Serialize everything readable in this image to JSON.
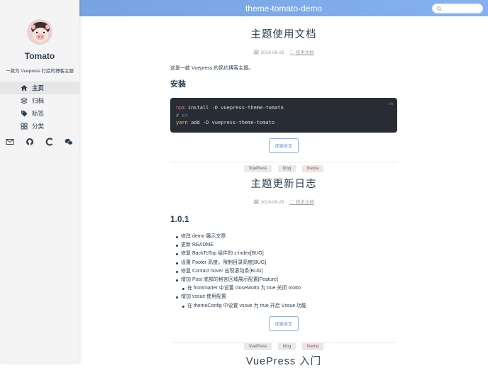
{
  "site": {
    "name": "Tomato",
    "description": "一款为 Vuepress 打造的博客主题",
    "header_title": "theme-tomato-demo"
  },
  "nav": [
    {
      "label": "主页",
      "icon": "home-icon",
      "active": true
    },
    {
      "label": "归档",
      "icon": "archive-icon",
      "active": false
    },
    {
      "label": "标签",
      "icon": "tag-icon",
      "active": false
    },
    {
      "label": "分类",
      "icon": "folder-icon",
      "active": false
    }
  ],
  "social": [
    "mail-icon",
    "github-icon",
    "coding-icon",
    "wechat-icon"
  ],
  "search": {
    "placeholder": ""
  },
  "posts": [
    {
      "title": "主题使用文档",
      "date": "2019-08-26",
      "category": "技术文档",
      "intro": "这是一款 Vuepress 的简约博客主题。",
      "heading": "安装",
      "code_lang": "sh",
      "code": {
        "line1_cmd": "npm",
        "line1_rest": " install -D vuepress-theme-tomato",
        "line2": "# or",
        "line3_cmd": "yarn",
        "line3_rest": " add -D vuepress-theme-tomato"
      },
      "read_more": "阅读全文",
      "tags": [
        "VuePress",
        "blog",
        "theme"
      ]
    },
    {
      "title": "主题更新日志",
      "date": "2019-08-26",
      "category": "技术文档",
      "heading": "1.0.1",
      "items": [
        {
          "text": "修改 demo 展示文章",
          "sub": false
        },
        {
          "text": "更新 README",
          "sub": false
        },
        {
          "text": "修复 BackToTop 组件的 z-index[BUG]",
          "sub": false
        },
        {
          "text": "设置 Footer 高度，限制目录高度[BUG]",
          "sub": false
        },
        {
          "text": "修复 Contact hover 出现滚动条[BUG]",
          "sub": false
        },
        {
          "text": "增加 Post 底部的格言区域展示配置[Feature]",
          "sub": false
        },
        {
          "text": "在 frontmatter 中设置 closeMotto 为 true 关闭 motto",
          "sub": true
        },
        {
          "text": "增加 vssue 使用配置",
          "sub": false
        },
        {
          "text": "在 themeConfig 中设置 vssue 为 true 开启 Vssue 功能",
          "sub": true
        }
      ],
      "read_more": "阅读全文",
      "tags": [
        "VuePress",
        "blog",
        "theme"
      ]
    },
    {
      "title": "VuePress 入门"
    }
  ],
  "colors": {
    "accent": "#84b1f0",
    "code_bg": "#282c34",
    "sidebar_bg": "#f4f4f4"
  }
}
